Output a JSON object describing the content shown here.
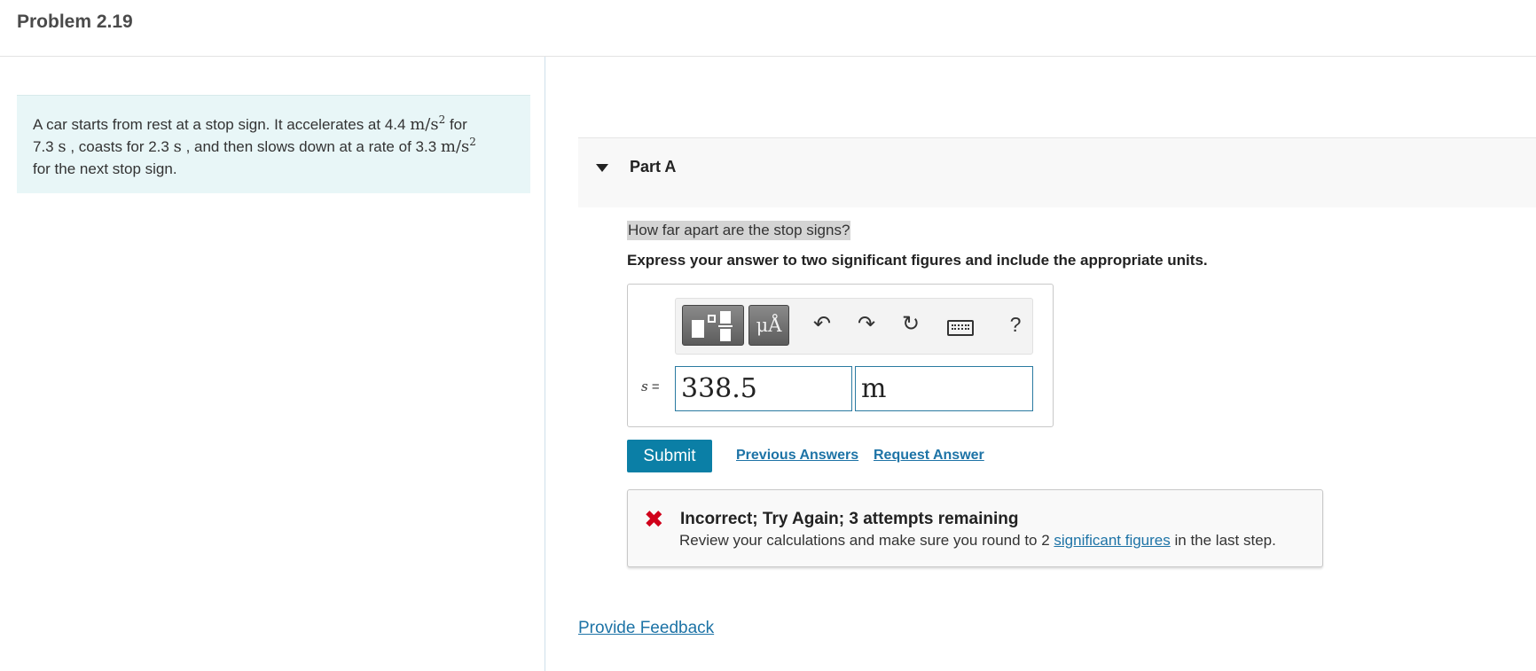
{
  "header": {
    "title": "Problem 2.19"
  },
  "problem": {
    "t1": "A car starts from rest at a stop sign. It accelerates at 4.4",
    "u1": "m/s",
    "e1": "2",
    "t2": "for",
    "t3": "7.3",
    "u2": "s",
    "t4": ", coasts for 2.3",
    "u3": "s",
    "t5": ", and then slows down at a rate of 3.3",
    "u4": "m/s",
    "e2": "2",
    "t6": "for the next stop sign."
  },
  "part": {
    "label": "Part A"
  },
  "question": {
    "text": "How far apart are the stop signs?",
    "instruction": "Express your answer to two significant figures and include the appropriate units."
  },
  "answer": {
    "toolbar": {
      "units_label": "μÅ",
      "undo_glyph": "↶",
      "redo_glyph": "↷",
      "reset_glyph": "↻",
      "help_label": "?"
    },
    "variable": "s",
    "equals": "=",
    "value": "338.5",
    "units": "m"
  },
  "actions": {
    "submit": "Submit",
    "previous_answers": "Previous Answers",
    "request_answer": "Request Answer"
  },
  "feedback": {
    "icon": "✖",
    "title": "Incorrect; Try Again; 3 attempts remaining",
    "msg_before": "Review your calculations and make sure you round to 2",
    "msg_link": "significant figures",
    "msg_after": "in the last step.",
    "icon_color": "#d0021b"
  },
  "footer": {
    "provide_feedback": "Provide Feedback"
  },
  "colors": {
    "accent": "#0b7fa6",
    "link": "#1d73a6",
    "problem_bg": "#e8f6f7"
  }
}
